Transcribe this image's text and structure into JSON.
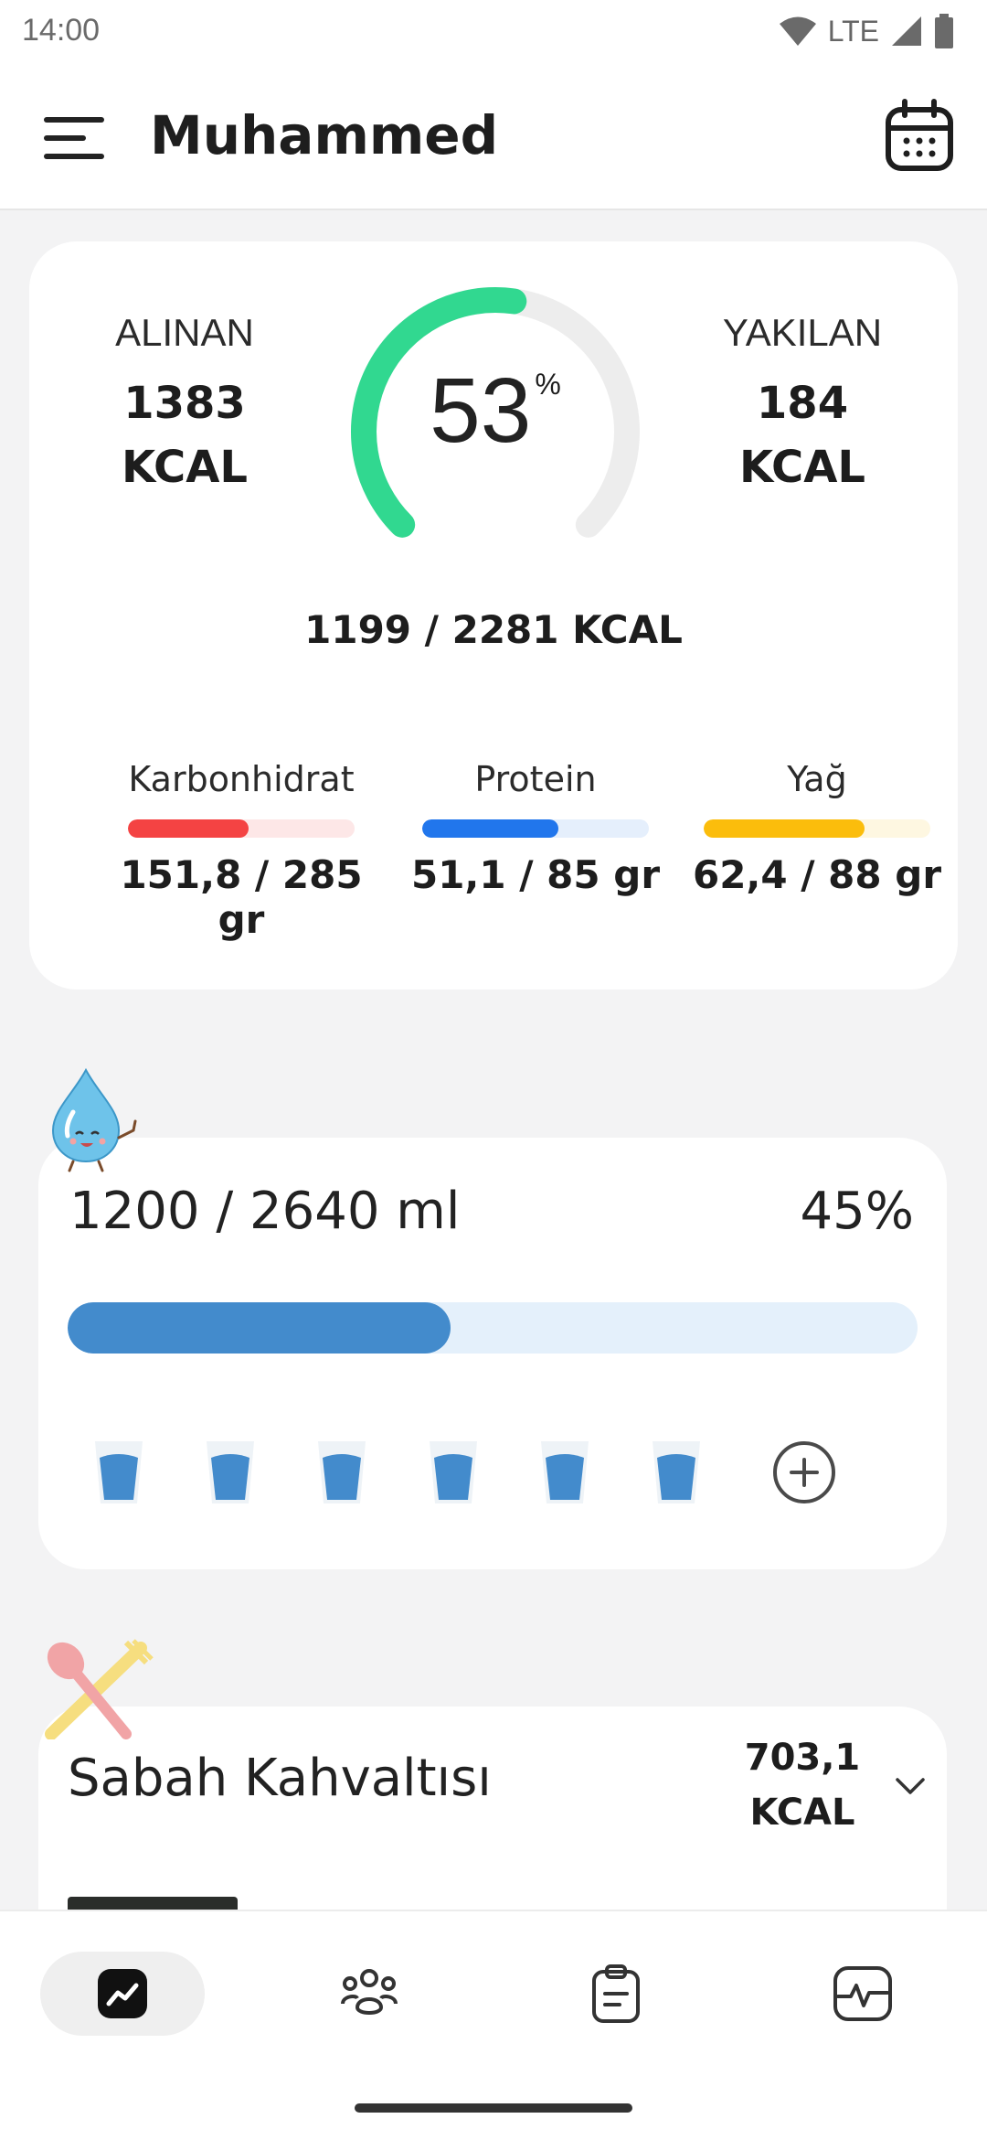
{
  "status_bar": {
    "time": "14:00",
    "network": "LTE"
  },
  "header": {
    "title": "Muhammed",
    "menu_icon": "menu-icon",
    "calendar_icon": "calendar-icon"
  },
  "calories": {
    "intake_label": "ALINAN",
    "intake_value": "1383",
    "intake_unit": "KCAL",
    "burned_label": "YAKILAN",
    "burned_value": "184",
    "burned_unit": "KCAL",
    "percent": "53",
    "percent_symbol": "%",
    "progress_fraction": 0.53,
    "total": "1199 / 2281 KCAL",
    "colors": {
      "gauge": "#31d890",
      "gauge_track": "#ededed"
    }
  },
  "macros": [
    {
      "label": "Karbonhidrat",
      "value": "151,8 / 285 gr",
      "fraction": 0.533,
      "color": "#f44343",
      "track_color": "#fde7e7"
    },
    {
      "label": "Protein",
      "value": "51,1 / 85 gr",
      "fraction": 0.601,
      "color": "#2176ec",
      "track_color": "#e5effc"
    },
    {
      "label": "Yağ",
      "value": "62,4 / 88 gr",
      "fraction": 0.709,
      "color": "#fbbd0c",
      "track_color": "#fef7e1"
    }
  ],
  "water": {
    "amount": "1200 / 2640 ml",
    "percent": "45%",
    "fraction": 0.45,
    "glass_count": 6,
    "mascot_icon": "water-drop-mascot-icon",
    "glass_icon": "water-glass-icon",
    "add_icon": "add-circle-icon",
    "colors": {
      "fill": "#438bcc",
      "track": "#e4f0fb"
    }
  },
  "meal": {
    "name": "Sabah Kahvaltısı",
    "kcal_value": "703,1",
    "kcal_unit": "KCAL",
    "icon": "spoon-fork-icon",
    "expand_icon": "chevron-down-icon"
  },
  "bottom_nav": [
    {
      "id": "dashboard",
      "icon": "trend-chart-icon",
      "active": true
    },
    {
      "id": "community",
      "icon": "group-icon",
      "active": false
    },
    {
      "id": "plan",
      "icon": "clipboard-icon",
      "active": false
    },
    {
      "id": "activity",
      "icon": "pulse-monitor-icon",
      "active": false
    }
  ]
}
